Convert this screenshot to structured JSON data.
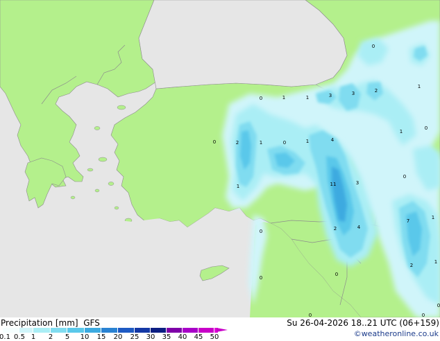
{
  "legend": {
    "title": "Precipitation [mm]",
    "model": "GFS",
    "datetime": "Su 26-04-2026 18..21 UTC (06+159)",
    "credit": "©weatheronline.co.uk",
    "ticks": [
      "0.1",
      "0.5",
      "1",
      "2",
      "5",
      "10",
      "15",
      "20",
      "25",
      "30",
      "35",
      "40",
      "45",
      "50"
    ],
    "colors": [
      "#f5fefe",
      "#d0f5fa",
      "#aaeef5",
      "#80dcf0",
      "#5ac8ea",
      "#3caae0",
      "#2a82d2",
      "#1e5ac3",
      "#1438a5",
      "#0c1e82",
      "#7e00a8",
      "#a800c8",
      "#c800c8",
      "#e000d8"
    ]
  },
  "map": {
    "colors": {
      "sea": "#e6e6e6",
      "land": "#b4f08c",
      "border": "#8c8c8c"
    },
    "values": [
      "0",
      "1",
      "1",
      "3",
      "3",
      "2",
      "0",
      "0",
      "2",
      "1",
      "0",
      "1",
      "4",
      "1",
      "11",
      "3",
      "2",
      "4",
      "0",
      "0",
      "1",
      "7",
      "1",
      "2",
      "1",
      "0",
      "0",
      "1",
      "0",
      "0",
      "0",
      "0"
    ]
  }
}
